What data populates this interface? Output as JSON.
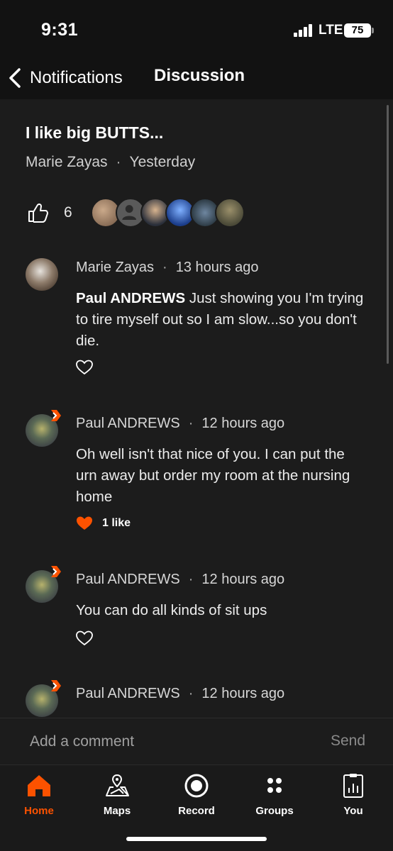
{
  "status_bar": {
    "time": "9:31",
    "network": "LTE",
    "battery": "75"
  },
  "header": {
    "back_label": "Notifications",
    "title": "Discussion"
  },
  "post": {
    "title": "I like big BUTTS...",
    "author": "Marie Zayas",
    "time": "Yesterday",
    "like_count": "6",
    "liker_avatars": [
      "avatar-1",
      "avatar-2",
      "avatar-3",
      "avatar-4",
      "avatar-5",
      "avatar-6"
    ]
  },
  "comments": [
    {
      "author": "Marie Zayas",
      "time": "13 hours ago",
      "mention": "Paul ANDREWS",
      "text": " Just showing you I'm trying to tire myself out so I am slow...so you don't die.",
      "liked": false,
      "likes_label": ""
    },
    {
      "author": "Paul ANDREWS",
      "time": "12 hours ago",
      "mention": "",
      "text": "Oh well isn't that nice of you. I can put the urn away but order my room at the nursing home",
      "liked": true,
      "likes_label": "1 like"
    },
    {
      "author": "Paul ANDREWS",
      "time": "12 hours ago",
      "mention": "",
      "text": "You can do all kinds of sit ups",
      "liked": false,
      "likes_label": ""
    },
    {
      "author": "Paul ANDREWS",
      "time": "12 hours ago",
      "mention": "",
      "text": "",
      "liked": false,
      "likes_label": ""
    }
  ],
  "comment_box": {
    "placeholder": "Add a comment",
    "send_label": "Send"
  },
  "tabs": [
    {
      "label": "Home",
      "icon": "home-icon",
      "active": true
    },
    {
      "label": "Maps",
      "icon": "maps-icon",
      "active": false
    },
    {
      "label": "Record",
      "icon": "record-icon",
      "active": false
    },
    {
      "label": "Groups",
      "icon": "groups-icon",
      "active": false
    },
    {
      "label": "You",
      "icon": "you-icon",
      "active": false
    }
  ],
  "colors": {
    "accent": "#fc5200",
    "background": "#1c1c1c",
    "header": "#121212"
  }
}
